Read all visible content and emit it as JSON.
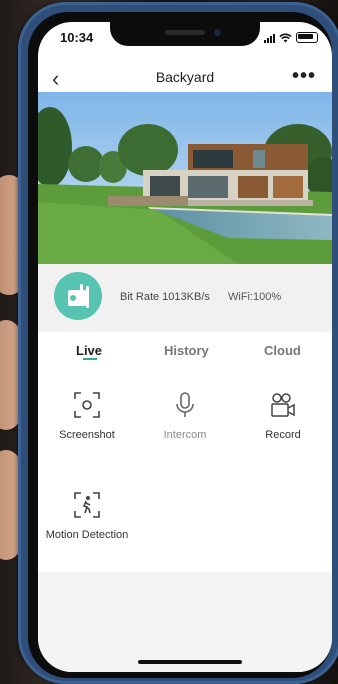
{
  "status": {
    "time": "10:34"
  },
  "header": {
    "back_icon": "chevron-left-icon",
    "title": "Backyard",
    "more_icon": "more-dots-icon"
  },
  "info": {
    "bitrate": "Bit Rate 1013KB/s",
    "wifi": "WiFi:100%"
  },
  "tabs": [
    {
      "label": "Live",
      "active": true
    },
    {
      "label": "History",
      "active": false
    },
    {
      "label": "Cloud",
      "active": false
    }
  ],
  "actions": [
    {
      "label": "Screenshot",
      "icon": "screenshot-icon",
      "enabled": true
    },
    {
      "label": "Intercom",
      "icon": "microphone-icon",
      "enabled": false
    },
    {
      "label": "Record",
      "icon": "video-camera-icon",
      "enabled": true
    },
    {
      "label": "Motion Detection",
      "icon": "motion-detection-icon",
      "enabled": true
    }
  ],
  "colors": {
    "accent": "#57c4b2",
    "tab_underline": "#3aa89a",
    "phone_case": "#2f4f7a"
  }
}
